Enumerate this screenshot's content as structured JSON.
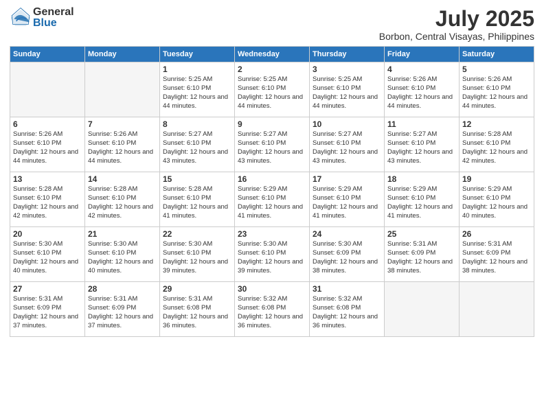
{
  "logo": {
    "general": "General",
    "blue": "Blue"
  },
  "header": {
    "month_year": "July 2025",
    "location": "Borbon, Central Visayas, Philippines"
  },
  "weekdays": [
    "Sunday",
    "Monday",
    "Tuesday",
    "Wednesday",
    "Thursday",
    "Friday",
    "Saturday"
  ],
  "weeks": [
    [
      {
        "day": "",
        "info": ""
      },
      {
        "day": "",
        "info": ""
      },
      {
        "day": "1",
        "info": "Sunrise: 5:25 AM\nSunset: 6:10 PM\nDaylight: 12 hours and 44 minutes."
      },
      {
        "day": "2",
        "info": "Sunrise: 5:25 AM\nSunset: 6:10 PM\nDaylight: 12 hours and 44 minutes."
      },
      {
        "day": "3",
        "info": "Sunrise: 5:25 AM\nSunset: 6:10 PM\nDaylight: 12 hours and 44 minutes."
      },
      {
        "day": "4",
        "info": "Sunrise: 5:26 AM\nSunset: 6:10 PM\nDaylight: 12 hours and 44 minutes."
      },
      {
        "day": "5",
        "info": "Sunrise: 5:26 AM\nSunset: 6:10 PM\nDaylight: 12 hours and 44 minutes."
      }
    ],
    [
      {
        "day": "6",
        "info": "Sunrise: 5:26 AM\nSunset: 6:10 PM\nDaylight: 12 hours and 44 minutes."
      },
      {
        "day": "7",
        "info": "Sunrise: 5:26 AM\nSunset: 6:10 PM\nDaylight: 12 hours and 44 minutes."
      },
      {
        "day": "8",
        "info": "Sunrise: 5:27 AM\nSunset: 6:10 PM\nDaylight: 12 hours and 43 minutes."
      },
      {
        "day": "9",
        "info": "Sunrise: 5:27 AM\nSunset: 6:10 PM\nDaylight: 12 hours and 43 minutes."
      },
      {
        "day": "10",
        "info": "Sunrise: 5:27 AM\nSunset: 6:10 PM\nDaylight: 12 hours and 43 minutes."
      },
      {
        "day": "11",
        "info": "Sunrise: 5:27 AM\nSunset: 6:10 PM\nDaylight: 12 hours and 43 minutes."
      },
      {
        "day": "12",
        "info": "Sunrise: 5:28 AM\nSunset: 6:10 PM\nDaylight: 12 hours and 42 minutes."
      }
    ],
    [
      {
        "day": "13",
        "info": "Sunrise: 5:28 AM\nSunset: 6:10 PM\nDaylight: 12 hours and 42 minutes."
      },
      {
        "day": "14",
        "info": "Sunrise: 5:28 AM\nSunset: 6:10 PM\nDaylight: 12 hours and 42 minutes."
      },
      {
        "day": "15",
        "info": "Sunrise: 5:28 AM\nSunset: 6:10 PM\nDaylight: 12 hours and 41 minutes."
      },
      {
        "day": "16",
        "info": "Sunrise: 5:29 AM\nSunset: 6:10 PM\nDaylight: 12 hours and 41 minutes."
      },
      {
        "day": "17",
        "info": "Sunrise: 5:29 AM\nSunset: 6:10 PM\nDaylight: 12 hours and 41 minutes."
      },
      {
        "day": "18",
        "info": "Sunrise: 5:29 AM\nSunset: 6:10 PM\nDaylight: 12 hours and 41 minutes."
      },
      {
        "day": "19",
        "info": "Sunrise: 5:29 AM\nSunset: 6:10 PM\nDaylight: 12 hours and 40 minutes."
      }
    ],
    [
      {
        "day": "20",
        "info": "Sunrise: 5:30 AM\nSunset: 6:10 PM\nDaylight: 12 hours and 40 minutes."
      },
      {
        "day": "21",
        "info": "Sunrise: 5:30 AM\nSunset: 6:10 PM\nDaylight: 12 hours and 40 minutes."
      },
      {
        "day": "22",
        "info": "Sunrise: 5:30 AM\nSunset: 6:10 PM\nDaylight: 12 hours and 39 minutes."
      },
      {
        "day": "23",
        "info": "Sunrise: 5:30 AM\nSunset: 6:10 PM\nDaylight: 12 hours and 39 minutes."
      },
      {
        "day": "24",
        "info": "Sunrise: 5:30 AM\nSunset: 6:09 PM\nDaylight: 12 hours and 38 minutes."
      },
      {
        "day": "25",
        "info": "Sunrise: 5:31 AM\nSunset: 6:09 PM\nDaylight: 12 hours and 38 minutes."
      },
      {
        "day": "26",
        "info": "Sunrise: 5:31 AM\nSunset: 6:09 PM\nDaylight: 12 hours and 38 minutes."
      }
    ],
    [
      {
        "day": "27",
        "info": "Sunrise: 5:31 AM\nSunset: 6:09 PM\nDaylight: 12 hours and 37 minutes."
      },
      {
        "day": "28",
        "info": "Sunrise: 5:31 AM\nSunset: 6:09 PM\nDaylight: 12 hours and 37 minutes."
      },
      {
        "day": "29",
        "info": "Sunrise: 5:31 AM\nSunset: 6:08 PM\nDaylight: 12 hours and 36 minutes."
      },
      {
        "day": "30",
        "info": "Sunrise: 5:32 AM\nSunset: 6:08 PM\nDaylight: 12 hours and 36 minutes."
      },
      {
        "day": "31",
        "info": "Sunrise: 5:32 AM\nSunset: 6:08 PM\nDaylight: 12 hours and 36 minutes."
      },
      {
        "day": "",
        "info": ""
      },
      {
        "day": "",
        "info": ""
      }
    ]
  ]
}
